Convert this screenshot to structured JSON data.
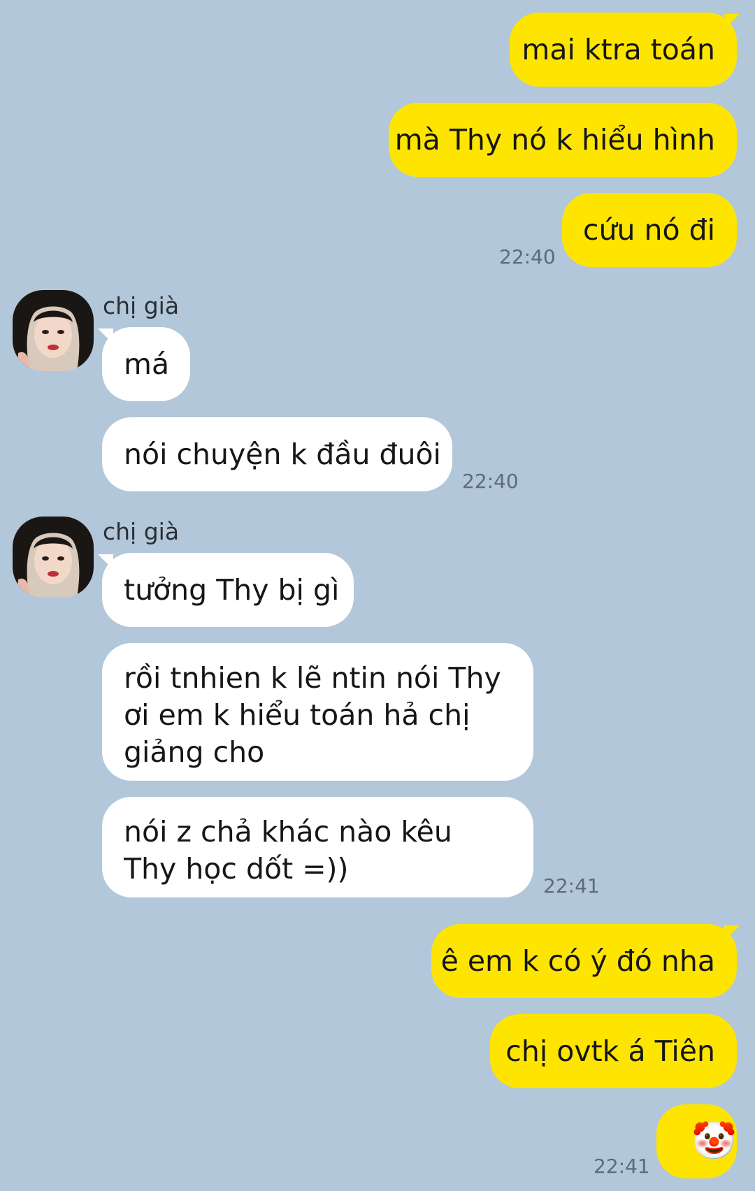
{
  "chat": {
    "contact_name": "chị già",
    "messages": {
      "m1": "mai ktra toán",
      "m2": "mà Thy nó k hiểu hình",
      "m3": "cứu nó đi",
      "t1": "22:40",
      "r1": "má",
      "r2": "nói chuyện k đầu đuôi",
      "t2": "22:40",
      "r3": "tưởng Thy bị gì",
      "r4": "rồi tnhien k lẽ ntin nói Thy ơi em k hiểu toán hả chị giảng cho",
      "r5": "nói z chả khác nào kêu Thy học dốt =))",
      "t3": "22:41",
      "m4": "ê em k có ý đó nha",
      "m5": "chị ovtk á Tiên",
      "m6": "🤡",
      "t4": "22:41"
    }
  },
  "colors": {
    "background": "#b2c7da",
    "outgoing_bubble": "#fee500",
    "incoming_bubble": "#ffffff",
    "timestamp": "#5e6b78"
  }
}
